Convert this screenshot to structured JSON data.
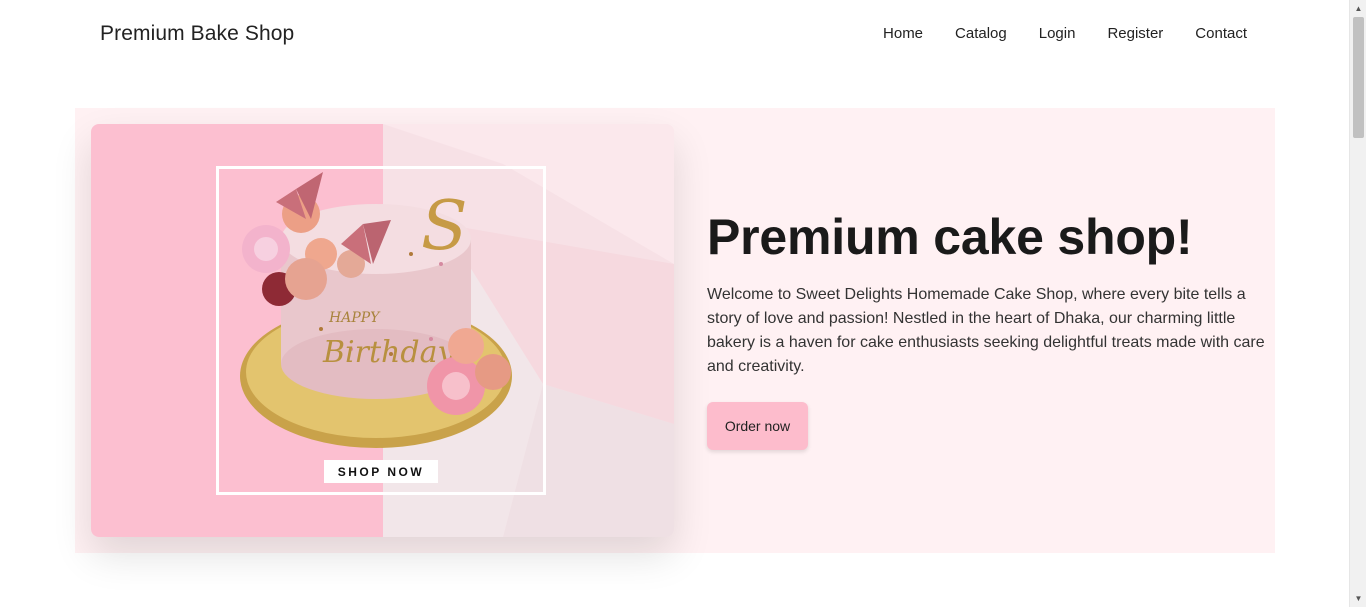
{
  "navbar": {
    "brand": "Premium Bake Shop",
    "links": [
      "Home",
      "Catalog",
      "Login",
      "Register",
      "Contact"
    ]
  },
  "hero": {
    "title": "Premium cake shop!",
    "description": "Welcome to Sweet Delights Homemade Cake Shop, where every bite tells a story of love and passion! Nestled in the heart of Dhaka, our charming little bakery is a haven for cake enthusiasts seeking delightful treats made with care and creativity.",
    "button_label": "Order now",
    "image": {
      "shop_now_label": "SHOP NOW",
      "cake_text": "Happy Birthday",
      "topper_letter": "S"
    }
  },
  "colors": {
    "hero_bg": "#fff1f3",
    "card_pink": "#fcbfd0",
    "button_pink": "#fdbccc"
  }
}
